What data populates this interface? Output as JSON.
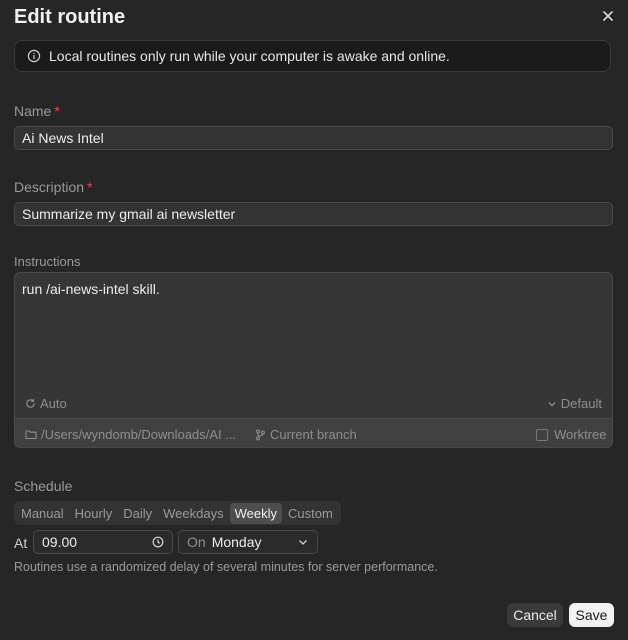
{
  "dialog": {
    "title": "Edit routine"
  },
  "banner": {
    "text": "Local routines only run while your computer is awake and online."
  },
  "name": {
    "label": "Name",
    "required_mark": "*",
    "value": "Ai News Intel"
  },
  "description": {
    "label": "Description",
    "required_mark": "*",
    "value": "Summarize my gmail ai newsletter"
  },
  "instructions": {
    "label": "Instructions",
    "value": "run /ai-news-intel skill.",
    "model_mode": "Auto",
    "model_default": "Default",
    "folder": "/Users/wyndomb/Downloads/AI ...",
    "branch": "Current branch",
    "worktree_label": "Worktree",
    "worktree_checked": false
  },
  "schedule": {
    "label": "Schedule",
    "options": [
      "Manual",
      "Hourly",
      "Daily",
      "Weekdays",
      "Weekly",
      "Custom"
    ],
    "selected": "Weekly",
    "at_label": "At",
    "time": "09.00",
    "on_label": "On",
    "day": "Monday",
    "hint": "Routines use a randomized delay of several minutes for server performance."
  },
  "actions": {
    "cancel_label": "Cancel",
    "save_label": "Save"
  },
  "colors": {
    "background": "#262626",
    "required": "#e5484d",
    "save_button": "#f2f2f2"
  }
}
